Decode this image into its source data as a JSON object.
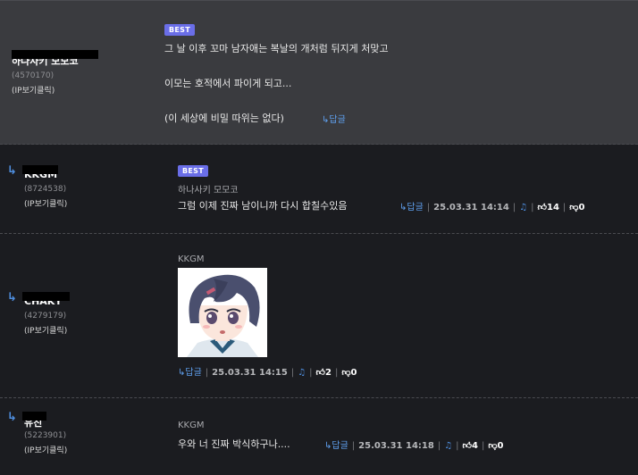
{
  "labels": {
    "best": "BEST",
    "reply": "↳답글",
    "ip_click": "(IP보기클릭)"
  },
  "comments": [
    {
      "author": "하나사키 모모코",
      "uid": "(4570170)",
      "best": true,
      "lines": [
        "그 날 이후 꼬마 남자애는 복날의 개처럼 뒤지게 처맞고",
        "이모는 호적에서 파이게 되고...",
        "(이 세상에 비밀 따위는 없다)"
      ]
    },
    {
      "author": "KKGM",
      "uid": "(8724538)",
      "best": true,
      "reply_to": "하나사키 모모코",
      "text": "그럼 이제 진짜 남이니까 다시 합칠수있음",
      "time": "25.03.31 14:14",
      "up": "14",
      "down": "0"
    },
    {
      "author": "CHAKY",
      "uid": "(4279179)",
      "reply_to": "KKGM",
      "time": "25.03.31 14:15",
      "up": "2",
      "down": "0"
    },
    {
      "author": "유진",
      "uid": "(5223901)",
      "reply_to": "KKGM",
      "text": "우와 너 진짜 박식하구나....",
      "time": "25.03.31 14:18",
      "up": "4",
      "down": "0"
    }
  ],
  "colors": {
    "best_badge": "#6a6ee8",
    "reply_link": "#5fa0ef",
    "highlight_bg": "#3a3b3f",
    "page_bg": "#1b1c20"
  },
  "icons": [
    "reply-arrow-icon",
    "bell-icon",
    "thumbs-up-icon",
    "thumbs-down-icon"
  ]
}
